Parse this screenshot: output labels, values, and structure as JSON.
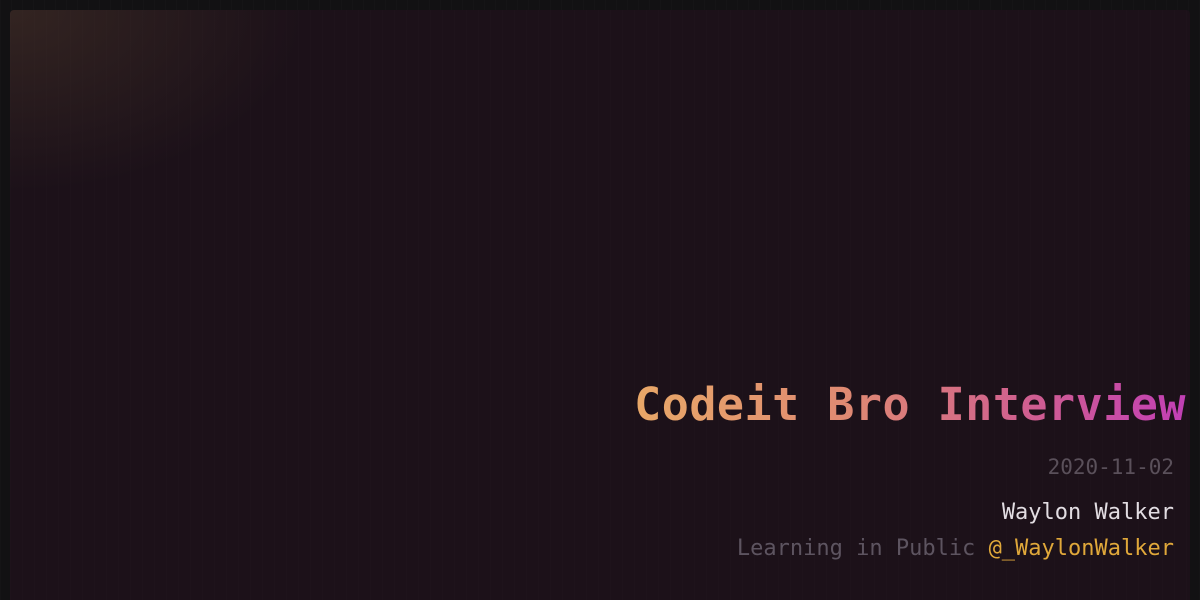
{
  "card": {
    "title": "Codeit Bro Interview",
    "date": "2020-11-02",
    "author": "Waylon Walker",
    "tagline_prefix": "Learning in Public",
    "handle": "@_WaylonWalker"
  },
  "colors": {
    "background": "#1c1119",
    "title_gradient_start": "#e8a868",
    "title_gradient_end": "#c23fb5",
    "date": "#5a505a",
    "author": "#e2dde2",
    "tagline": "#5d5460",
    "handle": "#e0a83a"
  }
}
